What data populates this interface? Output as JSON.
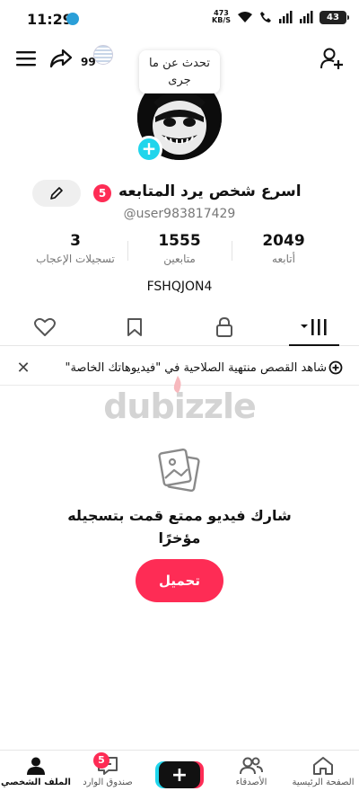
{
  "status_bar": {
    "time": "11:29",
    "net_speed_value": "473",
    "net_speed_unit": "KB/S",
    "battery": "43"
  },
  "header": {
    "badge_number": "99",
    "bubble_text": "تحدث عن ما جرى"
  },
  "profile": {
    "notification_count": "5",
    "display_name": "اسرع شخص يرد المتابعه",
    "username": "@user983817429",
    "bio": "FSHQJON4"
  },
  "stats": [
    {
      "value": "3",
      "label": "تسجيلات الإعجاب"
    },
    {
      "value": "1555",
      "label": "متابعين"
    },
    {
      "value": "2049",
      "label": "أتابعه"
    }
  ],
  "tabs": [
    {
      "icon": "heart-icon"
    },
    {
      "icon": "bookmark-icon"
    },
    {
      "icon": "lock-icon"
    },
    {
      "icon": "videos-grid-icon"
    }
  ],
  "banner": {
    "text": "شاهد القصص منتهية الصلاحية في \"فيديوهاتك الخاصة\""
  },
  "watermark": "dubizzle",
  "empty_state": {
    "text": "شارك فيديو ممتع قمت بتسجيله مؤخرًا",
    "button_label": "تحميل"
  },
  "bottom_nav": [
    {
      "label": "الملف الشخصي",
      "icon": "profile-icon",
      "active": true
    },
    {
      "label": "صندوق الوارد",
      "icon": "inbox-icon",
      "badge": "5"
    },
    {
      "label": "",
      "icon": "create-plus-icon"
    },
    {
      "label": "الأصدقاء",
      "icon": "friends-icon"
    },
    {
      "label": "الصفحة الرئيسية",
      "icon": "home-icon"
    }
  ],
  "colors": {
    "accent": "#fe2c55",
    "cyan": "#20d5ec",
    "text": "#161823",
    "muted": "#777777"
  }
}
